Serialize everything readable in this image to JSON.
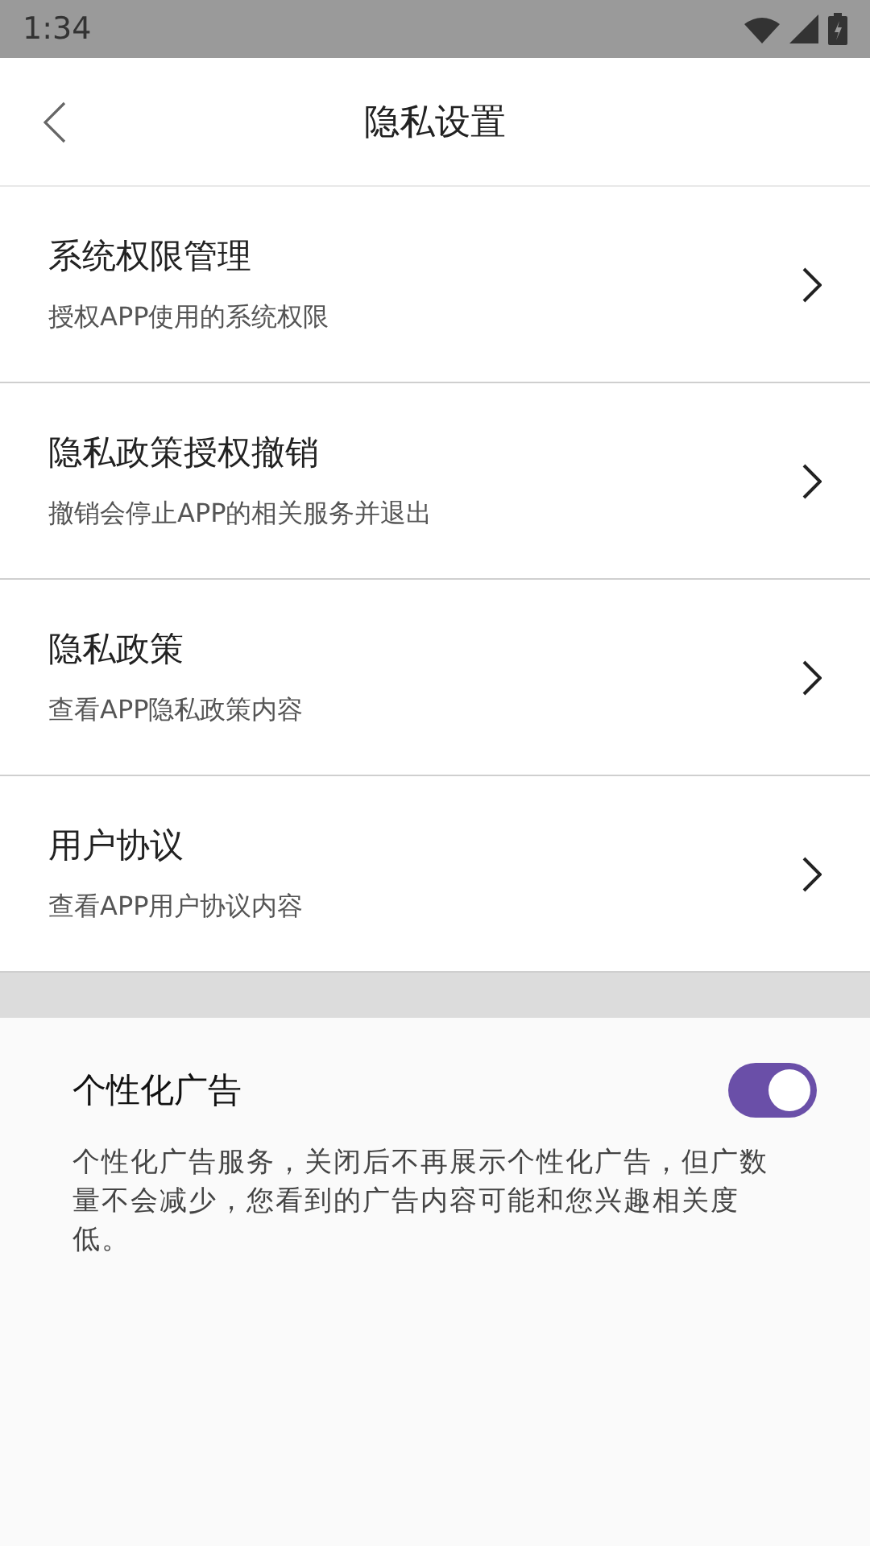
{
  "status_bar": {
    "time": "1:34"
  },
  "header": {
    "title": "隐私设置"
  },
  "items": [
    {
      "title": "系统权限管理",
      "subtitle": "授权APP使用的系统权限"
    },
    {
      "title": "隐私政策授权撤销",
      "subtitle": "撤销会停止APP的相关服务并退出"
    },
    {
      "title": "隐私政策",
      "subtitle": "查看APP隐私政策内容"
    },
    {
      "title": "用户协议",
      "subtitle": "查看APP用户协议内容"
    }
  ],
  "ad_setting": {
    "title": "个性化广告",
    "on": true,
    "description": "个性化广告服务，关闭后不再展示个性化广告，但广数量不会减少，您看到的广告内容可能和您兴趣相关度低。"
  }
}
